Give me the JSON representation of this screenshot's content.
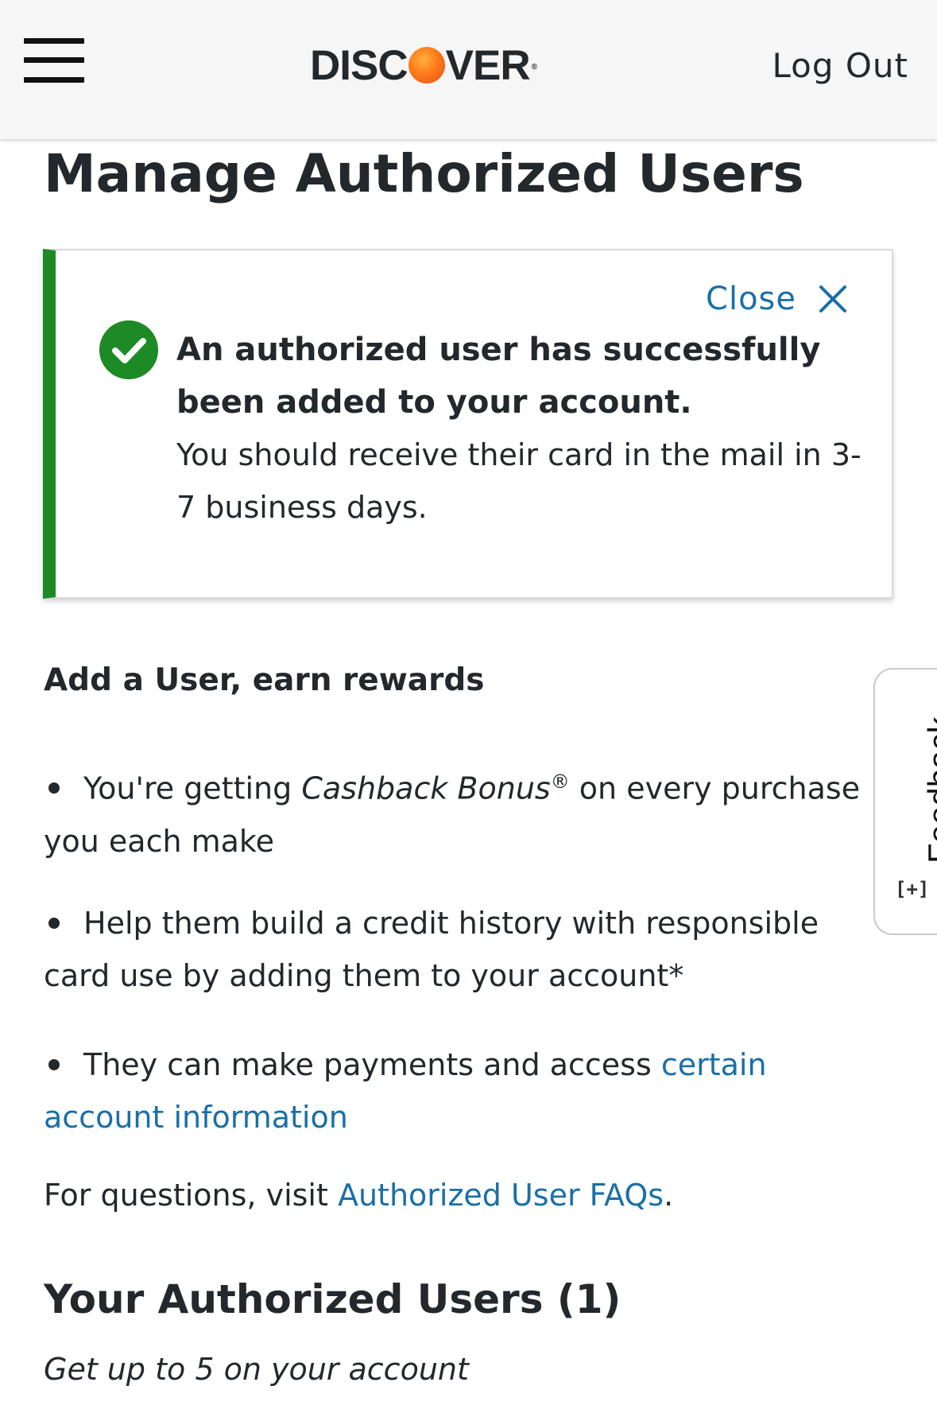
{
  "header": {
    "logo_prefix": "DISC",
    "logo_suffix": "VER",
    "logo_mark": "®",
    "logout_label": "Log Out"
  },
  "page": {
    "title": "Manage Authorized Users"
  },
  "alert": {
    "close_label": "Close",
    "title": "An authorized user has successfully been added to your account.",
    "body": "You should receive their card in the mail in 3-7 business days."
  },
  "rewards": {
    "heading": "Add a User, earn rewards",
    "bullet1_pre": "You're getting ",
    "bullet1_em": "Cashback Bonus",
    "bullet1_sup": "®",
    "bullet1_post": " on every purchase you each make",
    "bullet2": "Help them build a credit history with responsible card use by adding them to your account*",
    "bullet3_pre": "They can make payments and access ",
    "bullet3_link": "certain account information"
  },
  "faq": {
    "pre": "For questions, visit ",
    "link": "Authorized User FAQs",
    "post": "."
  },
  "users": {
    "heading": "Your Authorized Users (1)",
    "subtitle": "Get up to 5 on your account"
  },
  "feedback": {
    "label": "Feedback",
    "icon_text": "[+]"
  },
  "colors": {
    "accent_link": "#1a6fa8",
    "success_green": "#1e8a25",
    "logo_orange": "#ff7a1a",
    "text": "#23282d"
  },
  "icons": {
    "menu": "hamburger-menu-icon",
    "close": "close-icon",
    "success": "check-circle-icon"
  }
}
